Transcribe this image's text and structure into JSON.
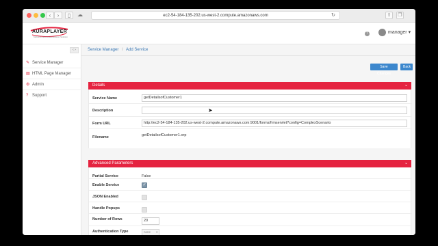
{
  "browser": {
    "url": "ec2-54-184-135-202.us-west-2.compute.amazonaws.com",
    "reload_icon": "reload-icon"
  },
  "header": {
    "logo_text": "AURAPLAYER",
    "logo_sub": "Mobile & Web Modernization Solution",
    "help_icon": "?",
    "user": "manager ▾"
  },
  "sidebar": {
    "collapse_label": "‹ ›",
    "items": [
      {
        "label": "Service Manager",
        "icon": "wrench-icon",
        "glyph": "✎"
      },
      {
        "label": "HTML Page Manager",
        "icon": "file-icon",
        "glyph": "▤"
      },
      {
        "label": "Admin",
        "icon": "gear-icon",
        "glyph": "⚙"
      },
      {
        "label": "Support",
        "icon": "question-icon",
        "glyph": "?"
      }
    ]
  },
  "breadcrumb": {
    "items": [
      "Service Manager",
      "Add Service"
    ],
    "separator": "/"
  },
  "toolbar": {
    "save_label": "Save Changes",
    "back_label": "Back"
  },
  "details": {
    "title": "Details",
    "fields": {
      "service_name_label": "Service Name",
      "service_name_value": "getDetailsofCustomer1",
      "description_label": "Description",
      "description_value": "",
      "form_url_label": "Form URL",
      "form_url_value": "http://ec2-54-184-135-202.us-west-2.compute.amazonaws.com:9001/forms/frmservlet?config=ComplexScenario",
      "filename_label": "Filename",
      "filename_value": "getDetailsofCustomer1.orp"
    }
  },
  "advanced": {
    "title": "Advanced Parameters",
    "partial_service_label": "Partial Service",
    "partial_service_value": "False",
    "enable_service_label": "Enable Service",
    "enable_service_checked": true,
    "json_enabled_label": "JSON Enabled",
    "json_enabled_checked": false,
    "handle_popups_label": "Handle Popups",
    "handle_popups_checked": false,
    "number_of_rows_label": "Number of Rows",
    "number_of_rows_value": "20",
    "auth_type_label": "Authentication Type",
    "auth_type_value": "none"
  },
  "colors": {
    "brand_red": "#e52340",
    "accent_blue": "#3c87cd"
  }
}
